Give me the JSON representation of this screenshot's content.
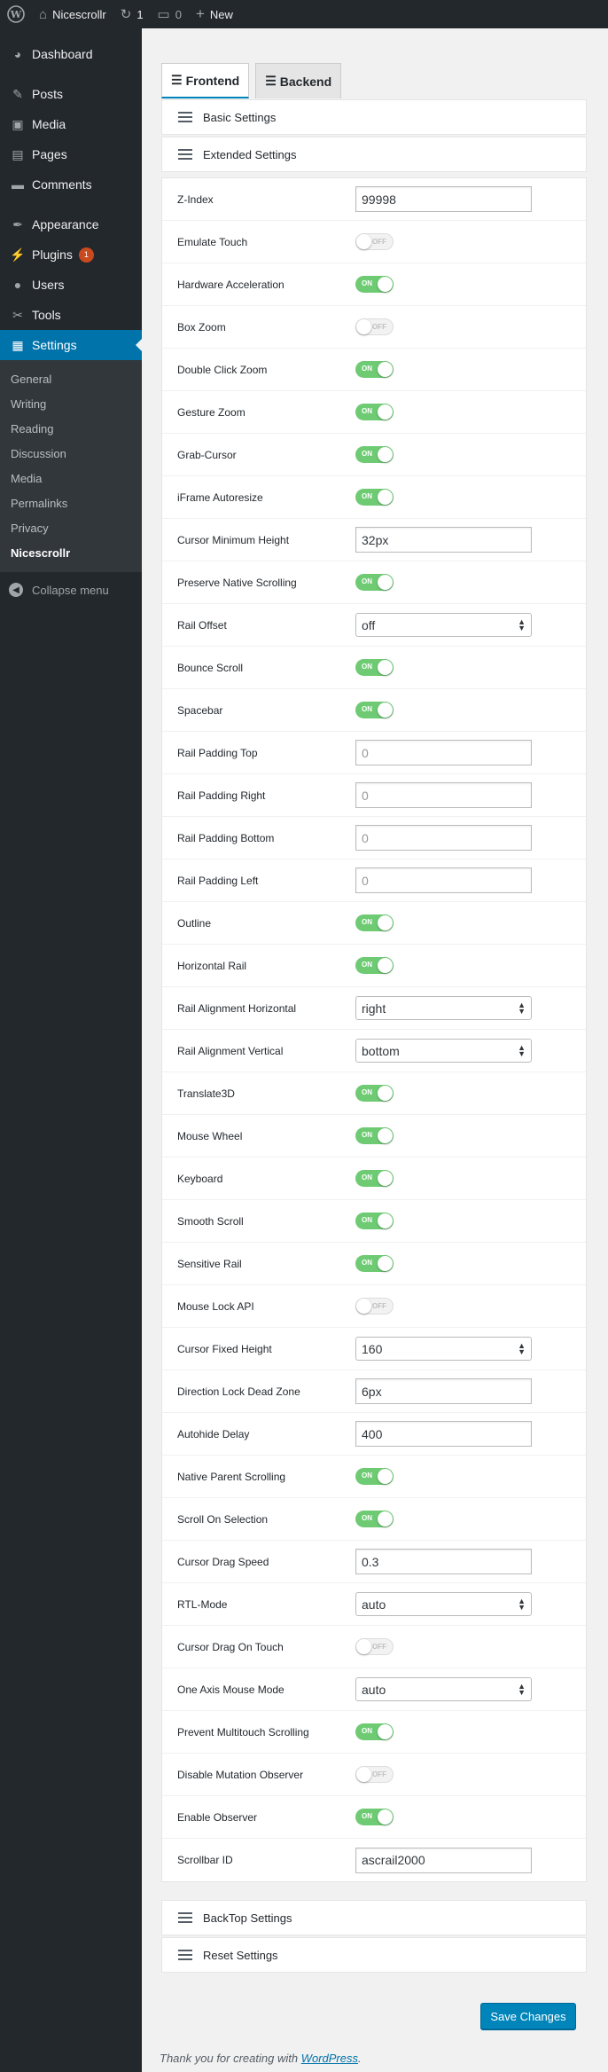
{
  "adminbar": {
    "site_name": "Nicescrollr",
    "updates_count": "1",
    "comments_count": "0",
    "new_label": "New"
  },
  "sidebar": {
    "items": [
      {
        "id": "dashboard",
        "label": "Dashboard",
        "icon": "dashboard-icon",
        "glyph": "◕"
      },
      {
        "id": "posts",
        "label": "Posts",
        "icon": "pin-icon",
        "glyph": "✎"
      },
      {
        "id": "media",
        "label": "Media",
        "icon": "media-icon",
        "glyph": "▣"
      },
      {
        "id": "pages",
        "label": "Pages",
        "icon": "pages-icon",
        "glyph": "▤"
      },
      {
        "id": "comments",
        "label": "Comments",
        "icon": "comment-icon",
        "glyph": "▬"
      },
      {
        "id": "appearance",
        "label": "Appearance",
        "icon": "brush-icon",
        "glyph": "✒"
      },
      {
        "id": "plugins",
        "label": "Plugins",
        "icon": "plugin-icon",
        "glyph": "⚡",
        "badge": "1"
      },
      {
        "id": "users",
        "label": "Users",
        "icon": "user-icon",
        "glyph": "●"
      },
      {
        "id": "tools",
        "label": "Tools",
        "icon": "wrench-icon",
        "glyph": "✂"
      },
      {
        "id": "settings",
        "label": "Settings",
        "icon": "settings-icon",
        "glyph": "▦"
      }
    ],
    "submenu": [
      "General",
      "Writing",
      "Reading",
      "Discussion",
      "Media",
      "Permalinks",
      "Privacy",
      "Nicescrollr"
    ],
    "collapse_label": "Collapse menu"
  },
  "tabs": {
    "frontend": "Frontend",
    "backend": "Backend"
  },
  "panels": {
    "basic": "Basic Settings",
    "extended": "Extended Settings",
    "backtop": "BackTop Settings",
    "reset": "Reset Settings"
  },
  "settings": [
    {
      "label": "Z-Index",
      "type": "text",
      "value": "99998"
    },
    {
      "label": "Emulate Touch",
      "type": "toggle",
      "state": "OFF"
    },
    {
      "label": "Hardware Acceleration",
      "type": "toggle",
      "state": "ON"
    },
    {
      "label": "Box Zoom",
      "type": "toggle",
      "state": "OFF"
    },
    {
      "label": "Double Click Zoom",
      "type": "toggle",
      "state": "ON"
    },
    {
      "label": "Gesture Zoom",
      "type": "toggle",
      "state": "ON"
    },
    {
      "label": "Grab-Cursor",
      "type": "toggle",
      "state": "ON"
    },
    {
      "label": "iFrame Autoresize",
      "type": "toggle",
      "state": "ON"
    },
    {
      "label": "Cursor Minimum Height",
      "type": "text",
      "value": "32px"
    },
    {
      "label": "Preserve Native Scrolling",
      "type": "toggle",
      "state": "ON"
    },
    {
      "label": "Rail Offset",
      "type": "select",
      "value": "off"
    },
    {
      "label": "Bounce Scroll",
      "type": "toggle",
      "state": "ON"
    },
    {
      "label": "Spacebar",
      "type": "toggle",
      "state": "ON"
    },
    {
      "label": "Rail Padding Top",
      "type": "text",
      "value": "",
      "placeholder": "0"
    },
    {
      "label": "Rail Padding Right",
      "type": "text",
      "value": "",
      "placeholder": "0"
    },
    {
      "label": "Rail Padding Bottom",
      "type": "text",
      "value": "",
      "placeholder": "0"
    },
    {
      "label": "Rail Padding Left",
      "type": "text",
      "value": "",
      "placeholder": "0"
    },
    {
      "label": "Outline",
      "type": "toggle",
      "state": "ON"
    },
    {
      "label": "Horizontal Rail",
      "type": "toggle",
      "state": "ON"
    },
    {
      "label": "Rail Alignment Horizontal",
      "type": "select",
      "value": "right"
    },
    {
      "label": "Rail Alignment Vertical",
      "type": "select",
      "value": "bottom"
    },
    {
      "label": "Translate3D",
      "type": "toggle",
      "state": "ON"
    },
    {
      "label": "Mouse Wheel",
      "type": "toggle",
      "state": "ON"
    },
    {
      "label": "Keyboard",
      "type": "toggle",
      "state": "ON"
    },
    {
      "label": "Smooth Scroll",
      "type": "toggle",
      "state": "ON"
    },
    {
      "label": "Sensitive Rail",
      "type": "toggle",
      "state": "ON"
    },
    {
      "label": "Mouse Lock API",
      "type": "toggle",
      "state": "OFF"
    },
    {
      "label": "Cursor Fixed Height",
      "type": "select",
      "value": "160"
    },
    {
      "label": "Direction Lock Dead Zone",
      "type": "text",
      "value": "6px"
    },
    {
      "label": "Autohide Delay",
      "type": "text",
      "value": "400"
    },
    {
      "label": "Native Parent Scrolling",
      "type": "toggle",
      "state": "ON"
    },
    {
      "label": "Scroll On Selection",
      "type": "toggle",
      "state": "ON"
    },
    {
      "label": "Cursor Drag Speed",
      "type": "text",
      "value": "0.3"
    },
    {
      "label": "RTL-Mode",
      "type": "select",
      "value": "auto"
    },
    {
      "label": "Cursor Drag On Touch",
      "type": "toggle",
      "state": "OFF"
    },
    {
      "label": "One Axis Mouse Mode",
      "type": "select",
      "value": "auto"
    },
    {
      "label": "Prevent Multitouch Scrolling",
      "type": "toggle",
      "state": "ON"
    },
    {
      "label": "Disable Mutation Observer",
      "type": "toggle",
      "state": "OFF"
    },
    {
      "label": "Enable Observer",
      "type": "toggle",
      "state": "ON"
    },
    {
      "label": "Scrollbar ID",
      "type": "text",
      "value": "ascrail2000"
    }
  ],
  "save_label": "Save Changes",
  "footer": {
    "text": "Thank you for creating with ",
    "link": "WordPress",
    "end": "."
  },
  "colors": {
    "accent": "#0073aa",
    "toggle_on": "#6ecb73",
    "adminbar": "#23282d"
  }
}
